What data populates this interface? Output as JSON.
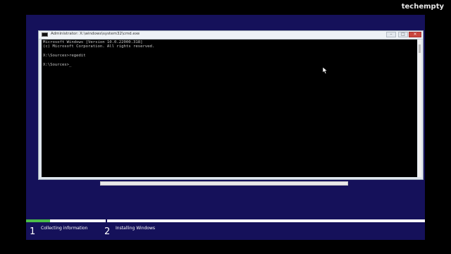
{
  "watermark": "techempty",
  "cmd": {
    "title": "Administrator: X:\\windows\\system32\\cmd.exe",
    "lines": [
      "Microsoft Windows [Version 10.0.22000.318]",
      "(c) Microsoft Corporation. All rights reserved.",
      "",
      "X:\\Sources>regedit",
      "",
      "X:\\Sources>_"
    ],
    "buttons": {
      "minimize": "–",
      "maximize": "□",
      "close": "×"
    }
  },
  "setup": {
    "progress": 0.06,
    "steps": [
      {
        "number": "1",
        "label": "Collecting information"
      },
      {
        "number": "2",
        "label": "Installing Windows"
      }
    ]
  },
  "colors": {
    "setup_background": "#15115a",
    "progress_fill": "#4dbd4a",
    "console_background": "#000000"
  }
}
